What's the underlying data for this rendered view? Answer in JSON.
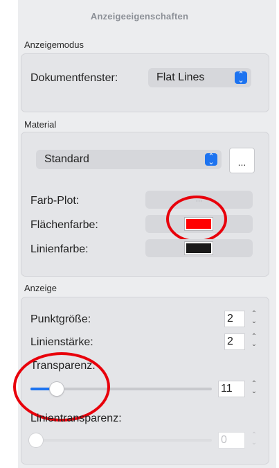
{
  "panel": {
    "title": "Anzeigeeigenschaften"
  },
  "display_mode": {
    "section_label": "Anzeigemodus",
    "document_window_label": "Dokumentfenster:",
    "document_window_value": "Flat Lines"
  },
  "material": {
    "section_label": "Material",
    "selected": "Standard",
    "more_button": "...",
    "color_plot_label": "Farb-Plot:",
    "color_plot_value": "...",
    "surface_color_label": "Flächenfarbe:",
    "surface_color": "#ff0000",
    "line_color_label": "Linienfarbe:",
    "line_color": "#1a1a1a"
  },
  "display": {
    "section_label": "Anzeige",
    "point_size_label": "Punktgröße:",
    "point_size": "2",
    "line_width_label": "Linienstärke:",
    "line_width": "2",
    "transparency_label": "Transparenz:",
    "transparency": "11",
    "line_transparency_label": "Linientransparenz:",
    "line_transparency": "0"
  },
  "colors": {
    "accent": "#1d73f0",
    "annotation": "#e8000b"
  },
  "icons": {
    "popup": "chevron-updown-icon",
    "stepper": "stepper-arrows-icon"
  }
}
